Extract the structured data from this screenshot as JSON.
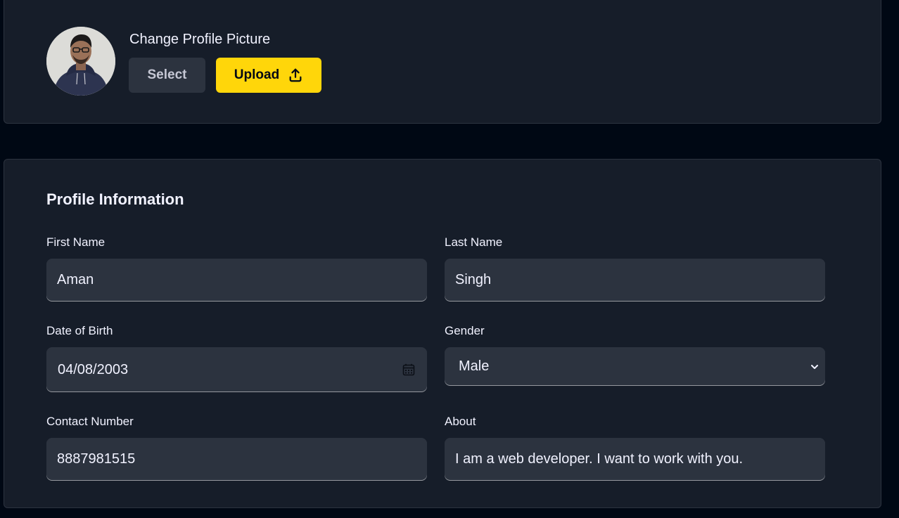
{
  "profile_picture": {
    "title": "Change Profile Picture",
    "select_label": "Select",
    "upload_label": "Upload",
    "upload_icon": "upload-icon"
  },
  "profile_information": {
    "title": "Profile Information",
    "fields": {
      "first_name": {
        "label": "First Name",
        "value": "Aman"
      },
      "last_name": {
        "label": "Last Name",
        "value": "Singh"
      },
      "date_of_birth": {
        "label": "Date of Birth",
        "value": "04/08/2003",
        "icon": "calendar-icon"
      },
      "gender": {
        "label": "Gender",
        "value": "Male",
        "icon": "chevron-down-icon"
      },
      "contact_number": {
        "label": "Contact Number",
        "value": "8887981515"
      },
      "about": {
        "label": "About",
        "value": "I am a web developer. I want to work with you."
      }
    }
  },
  "colors": {
    "page_background": "#000814",
    "card_background": "#161D29",
    "card_border": "#2C333F",
    "field_background": "#2C333F",
    "accent_yellow": "#FFD60A",
    "text_primary": "#F1F2FF"
  }
}
